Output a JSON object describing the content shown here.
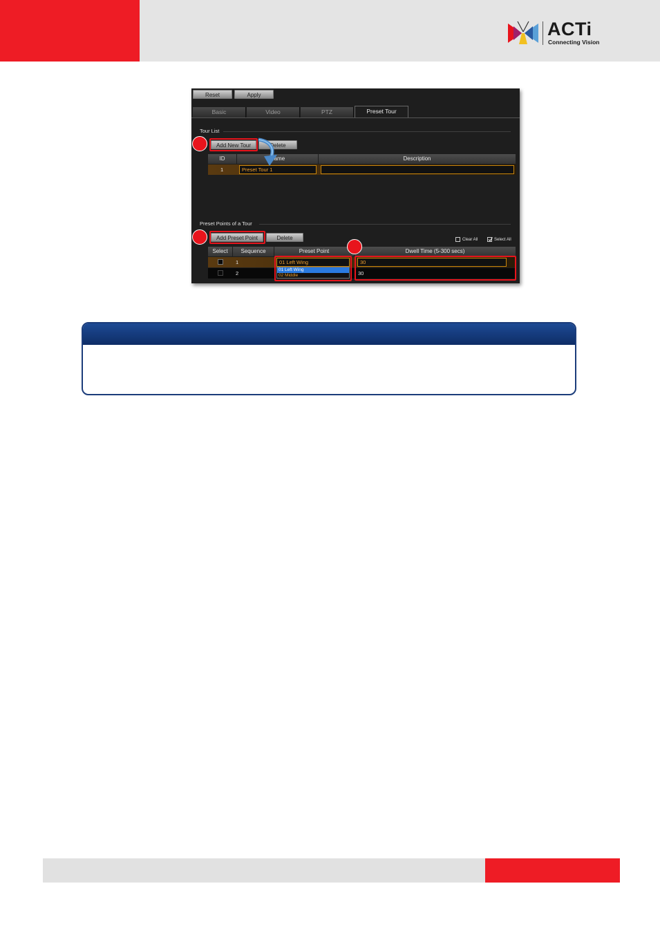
{
  "brand": {
    "name": "ACTi",
    "tagline": "Connecting Vision",
    "colors": {
      "red": "#ee1c25",
      "navy": "#1b3c7a",
      "orange": "#f0a030"
    }
  },
  "ui": {
    "toolbar": {
      "reset_label": "Reset",
      "apply_label": "Apply"
    },
    "tabs": [
      {
        "label": "Basic"
      },
      {
        "label": "Video"
      },
      {
        "label": "PTZ"
      },
      {
        "label": "Preset Tour",
        "active": true
      }
    ],
    "tour_list": {
      "title": "Tour List",
      "add_label": "Add New Tour",
      "delete_label": "Delete",
      "columns": [
        "ID",
        "Name",
        "Description"
      ],
      "rows": [
        {
          "id": "1",
          "name": "Preset Tour 1",
          "description": ""
        }
      ]
    },
    "preset_points": {
      "title": "Preset Points of a Tour",
      "add_label": "Add Preset Point",
      "delete_label": "Delete",
      "clear_all_label": "Clear All",
      "select_all_label": "Select All",
      "select_all_checked": true,
      "columns": [
        "Select",
        "Sequence",
        "Preset Point",
        "Dwell Time (5-300 secs)"
      ],
      "rows": [
        {
          "sequence": "1",
          "preset": "01 Left Wing",
          "dwell": "30",
          "checked": true
        },
        {
          "sequence": "2",
          "preset": "",
          "dwell": "30",
          "checked": false
        }
      ],
      "dropdown_options": [
        "01 Left Wing",
        "02 Middle"
      ]
    },
    "steps": [
      "",
      "",
      ""
    ]
  }
}
